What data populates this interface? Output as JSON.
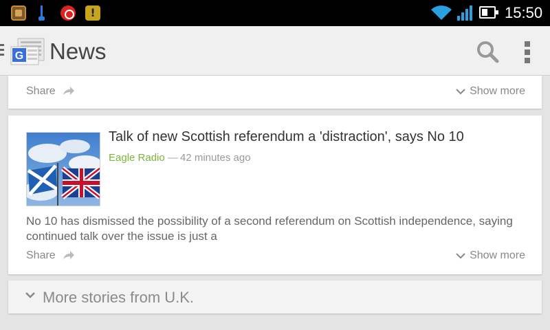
{
  "status_bar": {
    "icons": [
      "gallery-icon",
      "usb-icon",
      "screen-record-icon",
      "warning-icon",
      "wifi-icon",
      "signal-icon",
      "battery-icon"
    ],
    "time": "15:50"
  },
  "action_bar": {
    "title": "News",
    "icons": [
      "google-news-logo",
      "search-icon",
      "overflow-menu-icon"
    ]
  },
  "card_top": {
    "share_label": "Share",
    "show_more_label": "Show more"
  },
  "article": {
    "headline": "Talk of new Scottish referendum a 'distraction', says No 10",
    "source": "Eagle Radio",
    "separator": "—",
    "time": "42 minutes ago",
    "snippet": "No 10 has dismissed the possibility of a second referendum on Scottish independence, saying continued talk over the issue is just a",
    "share_label": "Share",
    "show_more_label": "Show more",
    "image": "flags-scotland-union-jack"
  },
  "more_stories": {
    "label": "More stories from U.K."
  },
  "colors": {
    "source_green": "#7bb339",
    "text_grey": "#888888",
    "background": "#e4e4e4"
  }
}
